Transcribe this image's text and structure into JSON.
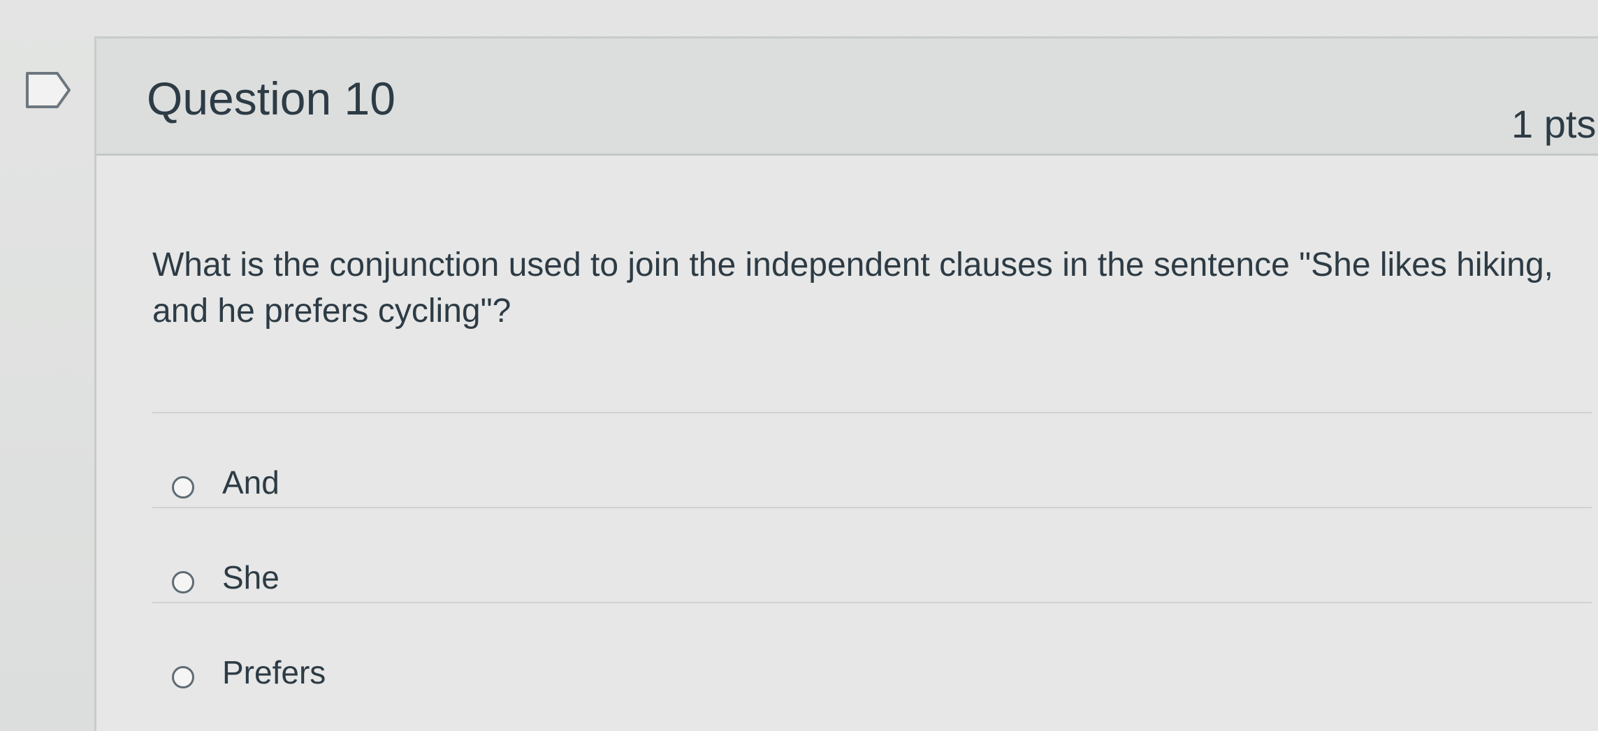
{
  "question": {
    "title": "Question 10",
    "points": "1 pts",
    "text": "What is the conjunction used to join the independent clauses in the sentence \"She likes hiking, and he prefers cycling\"?"
  },
  "answers": [
    {
      "label": "And",
      "selected": false
    },
    {
      "label": "She",
      "selected": false
    },
    {
      "label": "Prefers",
      "selected": false
    }
  ],
  "icons": {
    "flag": "flag-question-icon",
    "radio": "radio-unchecked-icon"
  }
}
